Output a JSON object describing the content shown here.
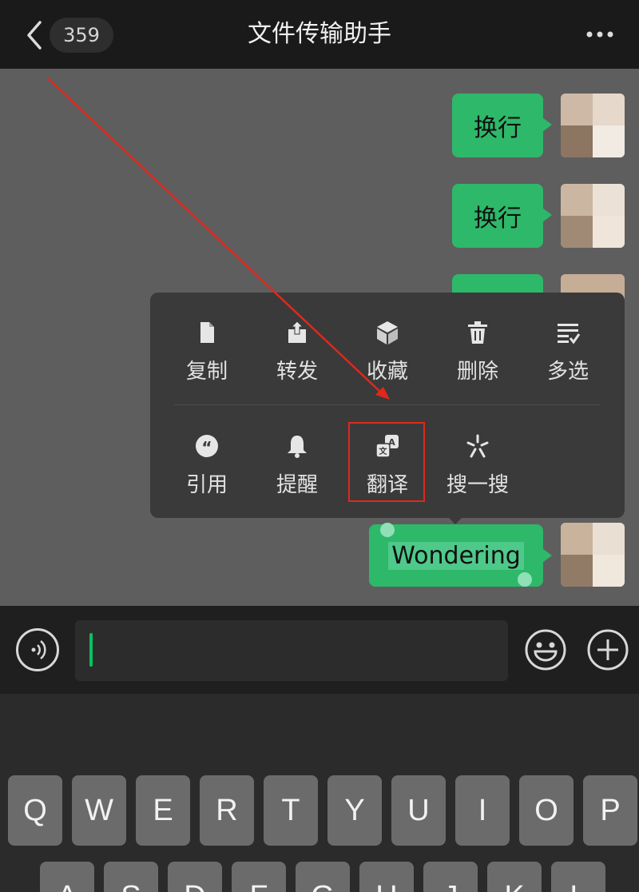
{
  "header": {
    "back_label": "<",
    "unread_count": "359",
    "title": "文件传输助手",
    "more_icon": "more-horizontal-icon"
  },
  "messages": [
    {
      "text": "换行"
    },
    {
      "text": "换行"
    },
    {
      "text": ""
    },
    {
      "text": "Wondering"
    }
  ],
  "context_menu": {
    "row1": [
      {
        "label": "复制",
        "icon": "copy-icon"
      },
      {
        "label": "转发",
        "icon": "forward-icon"
      },
      {
        "label": "收藏",
        "icon": "favorite-icon"
      },
      {
        "label": "删除",
        "icon": "delete-icon"
      },
      {
        "label": "多选",
        "icon": "multiselect-icon"
      }
    ],
    "row2": [
      {
        "label": "引用",
        "icon": "quote-icon"
      },
      {
        "label": "提醒",
        "icon": "remind-bell-icon"
      },
      {
        "label": "翻译",
        "icon": "translate-icon"
      },
      {
        "label": "搜一搜",
        "icon": "search-sparkle-icon"
      }
    ]
  },
  "input": {
    "value": "",
    "voice_icon": "voice-icon",
    "emoji_icon": "emoji-icon",
    "plus_icon": "plus-icon"
  },
  "keyboard": {
    "row1": [
      "Q",
      "W",
      "E",
      "R",
      "T",
      "Y",
      "U",
      "I",
      "O",
      "P"
    ],
    "row2": [
      "A",
      "S",
      "D",
      "F",
      "G",
      "H",
      "J",
      "K",
      "L"
    ]
  },
  "colors": {
    "bubble": "#2eb86a",
    "highlight_box": "#e0281c",
    "annotation_arrow": "#e0281c"
  }
}
